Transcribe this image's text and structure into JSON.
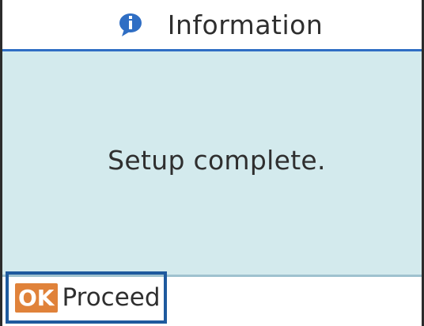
{
  "header": {
    "icon": "info-speech-bubble-icon",
    "title": "Information"
  },
  "main": {
    "message": "Setup complete."
  },
  "footer": {
    "ok_key_label": "OK",
    "proceed_label": "Proceed"
  },
  "colors": {
    "header_rule": "#2f6ec4",
    "content_background": "#d3eaed",
    "ok_key": "#e0823a",
    "focus_border": "#1f5a9e",
    "icon": "#2f6ec4"
  }
}
